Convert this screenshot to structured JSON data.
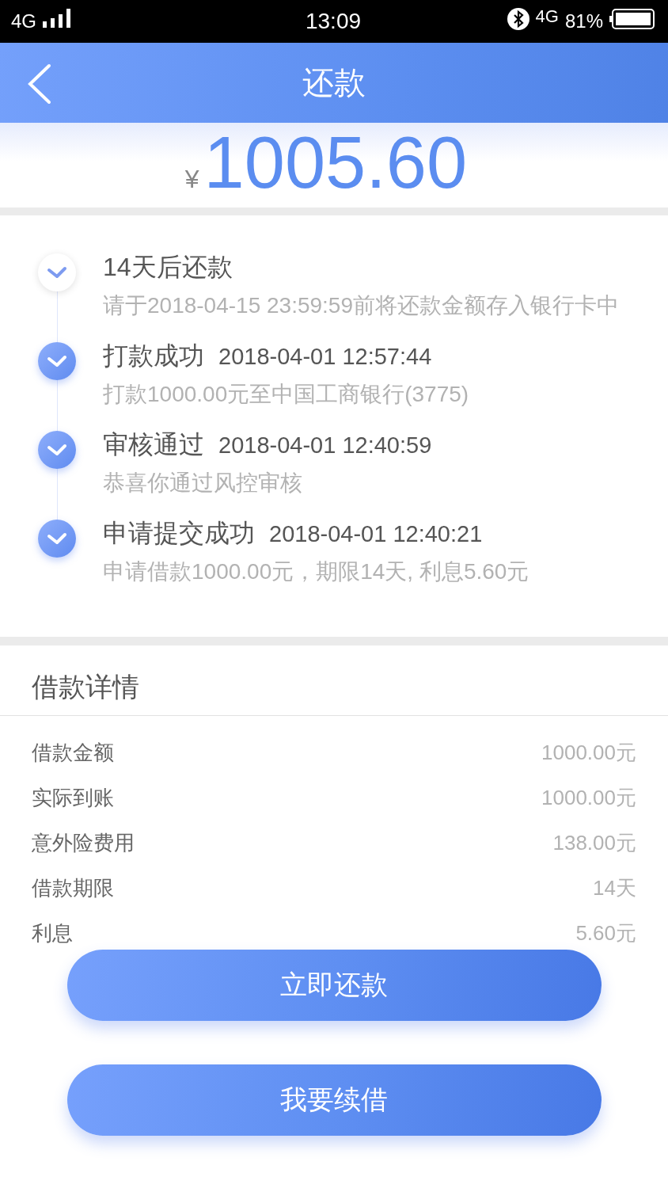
{
  "status_bar": {
    "network": "4G",
    "time": "13:09",
    "data_network": "4G",
    "battery": "81%"
  },
  "header": {
    "title": "还款"
  },
  "amount": {
    "currency": "¥",
    "value": "1005.60"
  },
  "timeline": [
    {
      "title": "14天后还款",
      "desc": "请于2018-04-15 23:59:59前将还款金额存入银行卡中",
      "done": false
    },
    {
      "title": "打款成功",
      "time": "2018-04-01 12:57:44",
      "desc": "打款1000.00元至中国工商银行(3775)",
      "done": true
    },
    {
      "title": "审核通过",
      "time": "2018-04-01 12:40:59",
      "desc": "恭喜你通过风控审核",
      "done": true
    },
    {
      "title": "申请提交成功",
      "time": "2018-04-01 12:40:21",
      "desc": "申请借款1000.00元，期限14天, 利息5.60元",
      "done": true
    }
  ],
  "details": {
    "title": "借款详情",
    "rows": [
      {
        "label": "借款金额",
        "value": "1000.00元"
      },
      {
        "label": "实际到账",
        "value": "1000.00元"
      },
      {
        "label": "意外险费用",
        "value": "138.00元"
      },
      {
        "label": "借款期限",
        "value": "14天"
      },
      {
        "label": "利息",
        "value": "5.60元"
      }
    ]
  },
  "buttons": [
    "立即还款",
    "我要续借"
  ]
}
